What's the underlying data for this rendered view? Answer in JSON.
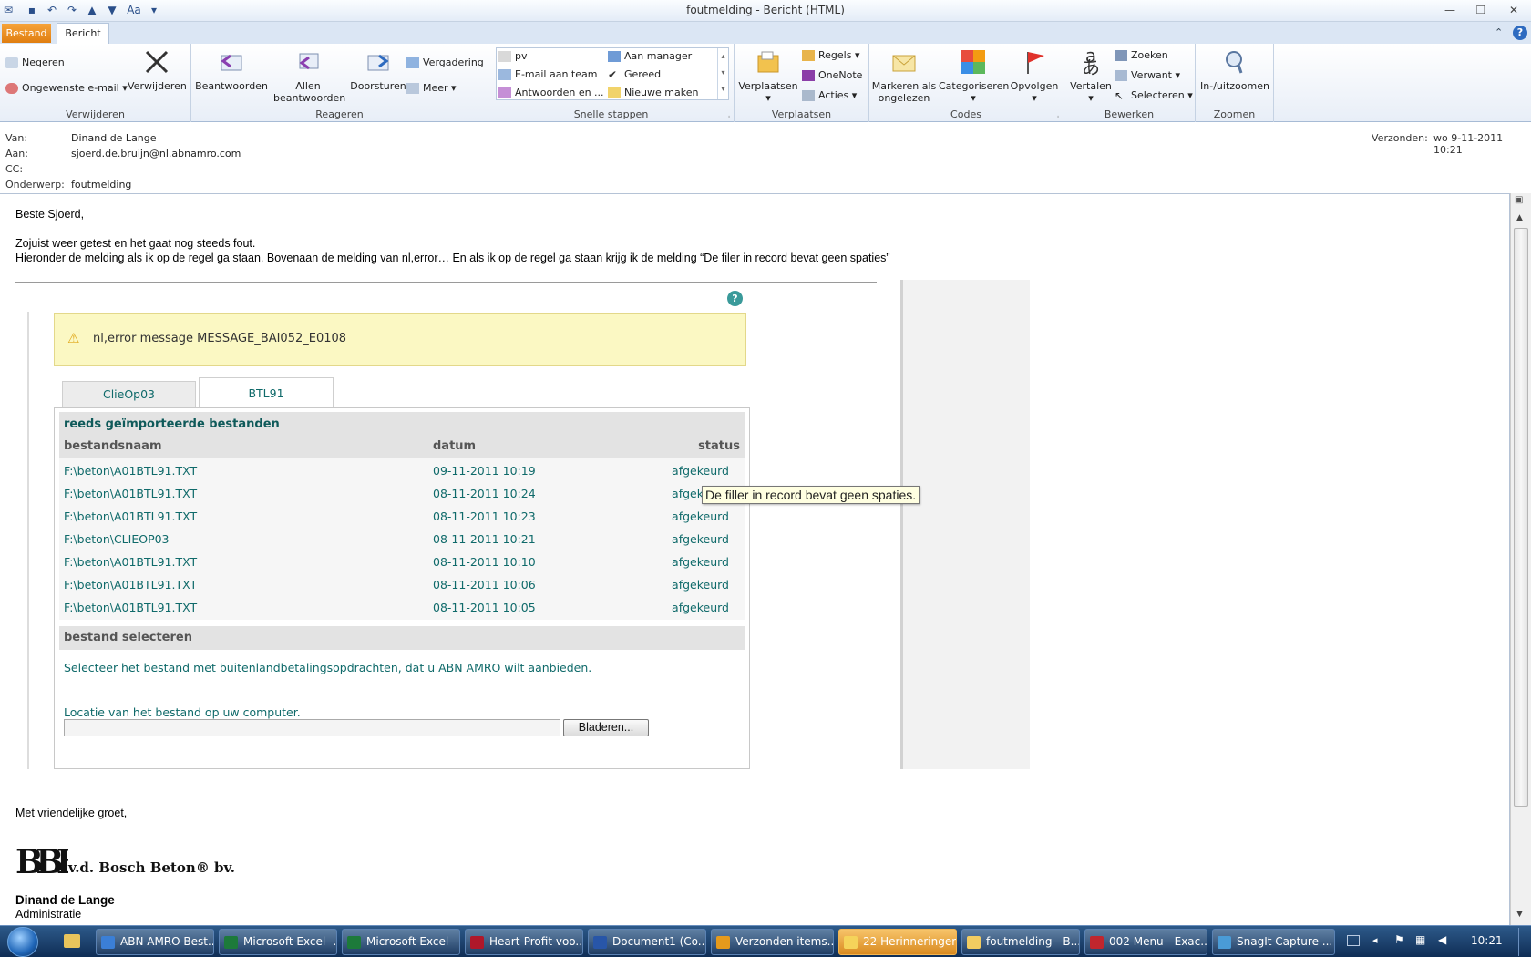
{
  "window": {
    "title": "foutmelding  -  Bericht (HTML)"
  },
  "ribbon_tabs": {
    "file": "Bestand",
    "message": "Bericht"
  },
  "ribbon": {
    "delete_group": {
      "label": "Verwijderen",
      "ignore": "Negeren",
      "junk": "Ongewenste e-mail",
      "delete": "Verwijderen"
    },
    "respond_group": {
      "label": "Reageren",
      "reply": "Beantwoorden",
      "reply_all_1": "Allen",
      "reply_all_2": "beantwoorden",
      "forward": "Doorsturen",
      "meeting": "Vergadering",
      "more": "Meer"
    },
    "quicksteps_group": {
      "label": "Snelle stappen",
      "items": [
        "pv",
        "Aan manager",
        "E-mail aan team",
        "Gereed",
        "Antwoorden en ...",
        "Nieuwe maken"
      ]
    },
    "move_group": {
      "label": "Verplaatsen",
      "move": "Verplaatsen",
      "rules": "Regels",
      "onenote": "OneNote",
      "actions": "Acties"
    },
    "tags_group": {
      "label": "Codes",
      "mark_unread_1": "Markeren als",
      "mark_unread_2": "ongelezen",
      "categorize": "Categoriseren",
      "follow_up": "Opvolgen"
    },
    "edit_group": {
      "label": "Bewerken",
      "translate": "Vertalen",
      "find": "Zoeken",
      "related": "Verwant",
      "select": "Selecteren"
    },
    "zoom_group": {
      "label": "Zoomen",
      "zoom": "In-/uitzoomen"
    }
  },
  "header": {
    "from_label": "Van:",
    "from": "Dinand de Lange",
    "to_label": "Aan:",
    "to": "sjoerd.de.bruijn@nl.abnamro.com",
    "cc_label": "CC:",
    "cc": "",
    "subject_label": "Onderwerp:",
    "subject": "foutmelding",
    "sent_label": "Verzonden:",
    "sent": "wo 9-11-2011 10:21"
  },
  "body": {
    "greeting": "Beste Sjoerd,",
    "line1": "Zojuist weer getest en het gaat nog steeds fout.",
    "line2": "Hieronder de melding als ik op de regel ga staan. Bovenaan de melding van nl,error… En als ik op de regel ga staan krijg ik de melding “De filer in record bevat geen spaties”",
    "closing": "Met vriendelijke groet,",
    "logo_text": "v.d. Bosch Beton",
    "logo_suffix": "bv.",
    "sig_name": "Dinand de Lange",
    "sig_role": "Administratie"
  },
  "app": {
    "error_message": "nl,error message MESSAGE_BAI052_E0108",
    "tabs": [
      "ClieOp03",
      "BTL91"
    ],
    "section_title": "reeds geïmporteerde bestanden",
    "columns": [
      "bestandsnaam",
      "datum",
      "status"
    ],
    "rows": [
      {
        "file": "F:\\beton\\A01BTL91.TXT",
        "date": "09-11-2011 10:19",
        "status": "afgekeurd"
      },
      {
        "file": "F:\\beton\\A01BTL91.TXT",
        "date": "08-11-2011 10:24",
        "status": "afgekeurd"
      },
      {
        "file": "F:\\beton\\A01BTL91.TXT",
        "date": "08-11-2011 10:23",
        "status": "afgekeurd"
      },
      {
        "file": "F:\\beton\\CLIEOP03",
        "date": "08-11-2011 10:21",
        "status": "afgekeurd"
      },
      {
        "file": "F:\\beton\\A01BTL91.TXT",
        "date": "08-11-2011 10:10",
        "status": "afgekeurd"
      },
      {
        "file": "F:\\beton\\A01BTL91.TXT",
        "date": "08-11-2011 10:06",
        "status": "afgekeurd"
      },
      {
        "file": "F:\\beton\\A01BTL91.TXT",
        "date": "08-11-2011 10:05",
        "status": "afgekeurd"
      }
    ],
    "tooltip": "De filler in record bevat geen spaties.",
    "select_title": "bestand selecteren",
    "select_desc": "Selecteer het bestand met buitenlandbetalingsopdrachten, dat u ABN AMRO wilt aanbieden.",
    "location_label": "Locatie van het bestand op uw computer.",
    "browse": "Bladeren..."
  },
  "taskbar": {
    "items": [
      "ABN AMRO Best...",
      "Microsoft Excel -...",
      "Microsoft Excel",
      "Heart-Profit voo...",
      "Document1 (Co...",
      "Verzonden items...",
      "22 Herinneringen",
      "foutmelding - B...",
      "002 Menu - Exac...",
      "SnagIt Capture ..."
    ],
    "clock": "10:21"
  },
  "colors": {
    "accent": "#0f6a6a",
    "error_bg": "#fbf8c3",
    "file_tab": "#e88a1a"
  }
}
